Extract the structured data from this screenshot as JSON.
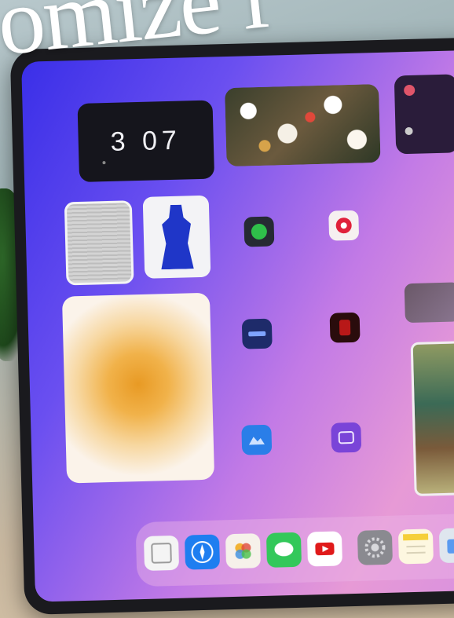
{
  "overlay_headline": "omize i",
  "clock_widget": {
    "time": "3 07"
  },
  "quote_widget": {
    "text": ""
  },
  "colors": {
    "wallpaper_start": "#3a2fe8",
    "wallpaper_end": "#e79ad6",
    "clock_bg": "#15151c",
    "accent_orange": "#e89a24"
  },
  "home_apps": [
    {
      "icon": "messages-icon",
      "color": "#2fbf4a"
    },
    {
      "icon": "pinterest-icon",
      "color": "#e0203a"
    },
    {
      "icon": "news-app-icon",
      "color": "#1e2b6a"
    },
    {
      "icon": "red-app-icon",
      "color": "#8a1010"
    },
    {
      "icon": "blue-app-icon",
      "color": "#2a7ee8"
    },
    {
      "icon": "purple-app-icon",
      "color": "#7a44d8"
    }
  ],
  "dock_apps": [
    {
      "icon": "calendar-icon",
      "color": "#f4f4f4"
    },
    {
      "icon": "safari-icon",
      "color": "#1e7ef0"
    },
    {
      "icon": "photos-icon",
      "color": "#f6f1ea"
    },
    {
      "icon": "messages-icon",
      "color": "#33c85a"
    },
    {
      "icon": "youtube-icon",
      "color": "#ffffff"
    },
    {
      "icon": "settings-icon",
      "color": "#8a8a90"
    },
    {
      "icon": "notes-icon",
      "color": "#fdf7e0"
    },
    {
      "icon": "files-icon",
      "color": "#dfe6ee"
    }
  ]
}
